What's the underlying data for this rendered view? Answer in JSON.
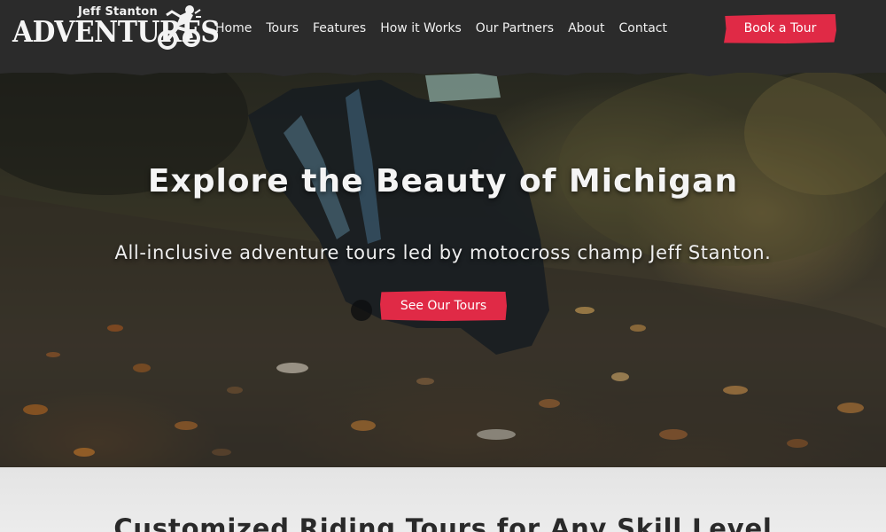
{
  "brand": {
    "top_line": "Jeff Stanton",
    "main_line": "ADVENTURES"
  },
  "nav": {
    "items": [
      {
        "label": "Home"
      },
      {
        "label": "Tours"
      },
      {
        "label": "Features"
      },
      {
        "label": "How it Works"
      },
      {
        "label": "Our Partners"
      },
      {
        "label": "About"
      },
      {
        "label": "Contact"
      }
    ],
    "cta_label": "Book a Tour"
  },
  "hero": {
    "title": "Explore the Beauty of Michigan",
    "subtitle": "All-inclusive adventure tours led by motocross champ Jeff Stanton.",
    "cta_label": "See Our Tours"
  },
  "section": {
    "title": "Customized Riding Tours for Any Skill Level"
  },
  "colors": {
    "header_bg": "#2b2b2b",
    "accent": "#e02a46",
    "section_bg": "#e8e8e8"
  }
}
